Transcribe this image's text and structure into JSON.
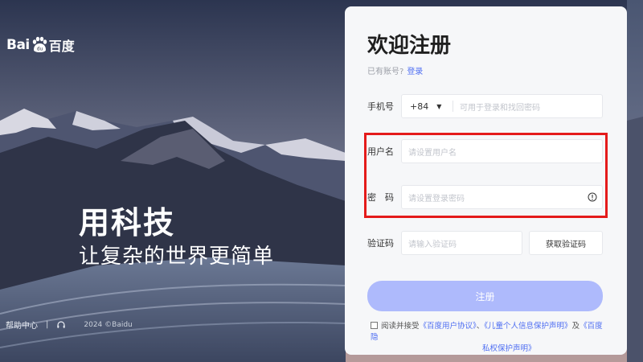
{
  "brand": {
    "logo_text_left": "Bai",
    "logo_text_right": "百度",
    "logo_mark_text": "du"
  },
  "slogan": {
    "main": "用科技",
    "sub": "让复杂的世界更简单"
  },
  "footer": {
    "help": "帮助中心",
    "separator": "|",
    "copyright": "2024 ©Baidu"
  },
  "form": {
    "title": "欢迎注册",
    "have_account": "已有账号?",
    "login_link": "登录",
    "phone": {
      "label": "手机号",
      "country_code": "+84",
      "placeholder": "可用于登录和找回密码"
    },
    "username": {
      "label": "用户名",
      "placeholder": "请设置用户名"
    },
    "password": {
      "label": "密　码",
      "placeholder": "请设置登录密码"
    },
    "code": {
      "label": "验证码",
      "placeholder": "请输入验证码",
      "button": "获取验证码"
    },
    "submit": "注册",
    "agreement": {
      "prefix": "阅读并接受",
      "link1": "《百度用户协议》",
      "sep": "、",
      "link2": "《儿童个人信息保护声明》",
      "and": "及",
      "link3a": "《百度隐",
      "link3b": "私权保护声明》"
    }
  },
  "colors": {
    "accent": "#4e6ef2",
    "submit_bg": "#aebafc",
    "highlight": "#e41b1b"
  }
}
